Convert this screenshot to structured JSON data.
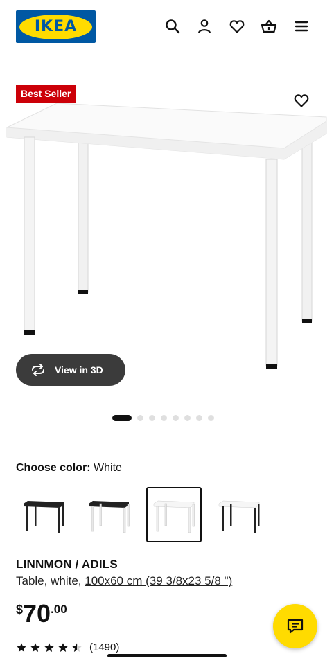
{
  "header": {
    "logo_text": "IKEA",
    "icons": [
      "search-icon",
      "account-icon",
      "heart-icon",
      "basket-icon",
      "menu-icon"
    ]
  },
  "product": {
    "badge": "Best Seller",
    "view_3d_label": "View in 3D",
    "carousel": {
      "total": 8,
      "active_index": 0
    },
    "color_label": "Choose color:",
    "color_value": "White",
    "swatches": [
      {
        "name": "black-brown",
        "selected": false
      },
      {
        "name": "black-white",
        "selected": false
      },
      {
        "name": "white",
        "selected": true
      },
      {
        "name": "white-black",
        "selected": false
      }
    ],
    "name": "LINNMON / ADILS",
    "description_prefix": "Table, white, ",
    "description_dimensions": "100x60 cm (39 3/8x23 5/8 \")",
    "price": {
      "currency": "$",
      "integer": "70",
      "decimals": ".00"
    },
    "rating": {
      "stars": 4.5,
      "max": 5,
      "count": "(1490)"
    }
  },
  "colors": {
    "ikea_blue": "#0058a3",
    "ikea_yellow": "#ffdb00",
    "badge_red": "#cc0008",
    "dark_button": "#3b3b3b"
  }
}
